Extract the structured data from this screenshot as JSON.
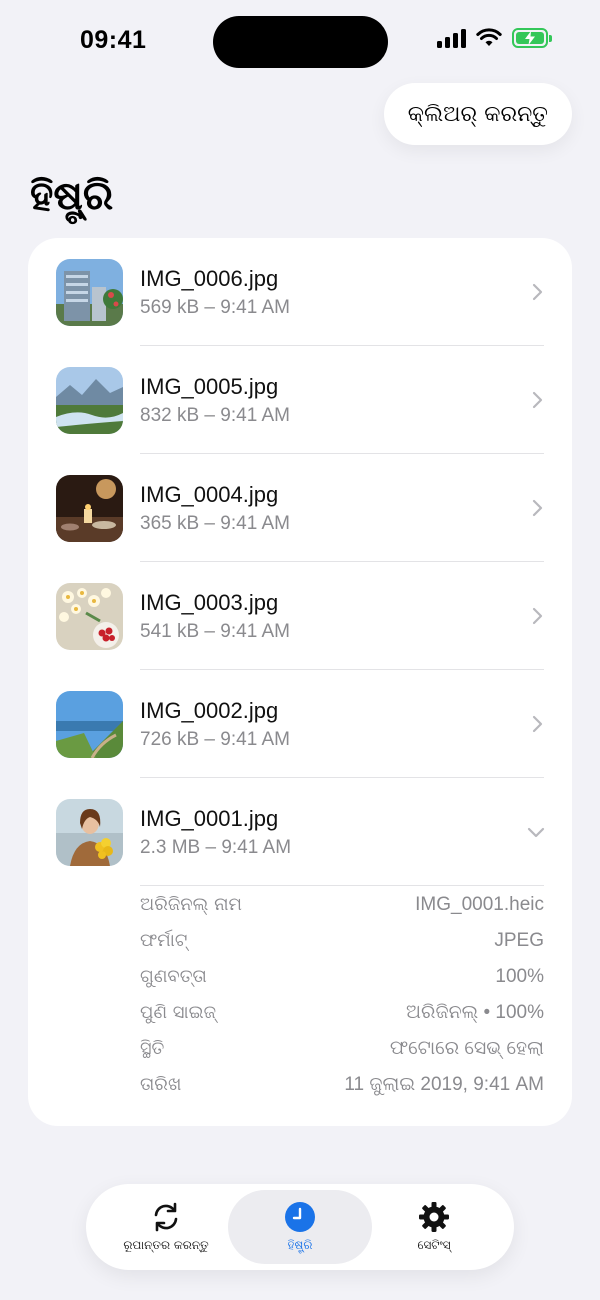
{
  "status": {
    "time": "09:41"
  },
  "header": {
    "clear_label": "କ୍ଲିଅର୍ କରନ୍ତୁ",
    "title": "ହିଷ୍ଟ୍ରି"
  },
  "history": [
    {
      "name": "IMG_0006.jpg",
      "meta": "569 kB – 9:41 AM",
      "thumb": "city-building"
    },
    {
      "name": "IMG_0005.jpg",
      "meta": "832 kB – 9:41 AM",
      "thumb": "mountain-river"
    },
    {
      "name": "IMG_0004.jpg",
      "meta": "365 kB – 9:41 AM",
      "thumb": "candle-dinner"
    },
    {
      "name": "IMG_0003.jpg",
      "meta": "541 kB – 9:41 AM",
      "thumb": "flowers-berries"
    },
    {
      "name": "IMG_0002.jpg",
      "meta": "726 kB – 9:41 AM",
      "thumb": "coastal-path"
    },
    {
      "name": "IMG_0001.jpg",
      "meta": "2.3 MB – 9:41 AM",
      "thumb": "woman-flowers",
      "expanded": true
    }
  ],
  "details": [
    {
      "label": "ଅରିଜିନଲ୍ ନାମ",
      "value": "IMG_0001.heic"
    },
    {
      "label": "ଫର୍ମାଟ୍",
      "value": "JPEG"
    },
    {
      "label": "ଗୁଣବତ୍ତା",
      "value": "100%"
    },
    {
      "label": "ପୁଣି ସାଇଜ୍",
      "value": "ଅରିଜିନଲ୍ • 100%"
    },
    {
      "label": "ସ୍ଥିତି",
      "value": "ଫଟୋରେ ସେଭ୍ ହେଲା"
    },
    {
      "label": "ତାରିଖ",
      "value": "11 ଜୁଲାଇ 2019, 9:41 AM"
    }
  ],
  "tabs": [
    {
      "label": "ରୂପାନ୍ତର କରନ୍ତୁ",
      "icon": "convert-arrows-icon",
      "active": false
    },
    {
      "label": "ହିଷ୍ଟ୍ରି",
      "icon": "clock-icon",
      "active": true
    },
    {
      "label": "ସେଟିଂସ୍",
      "icon": "gear-icon",
      "active": false
    }
  ],
  "colors": {
    "accent": "#1a73e8",
    "battery": "#34c759",
    "background": "#f2f2f7"
  }
}
